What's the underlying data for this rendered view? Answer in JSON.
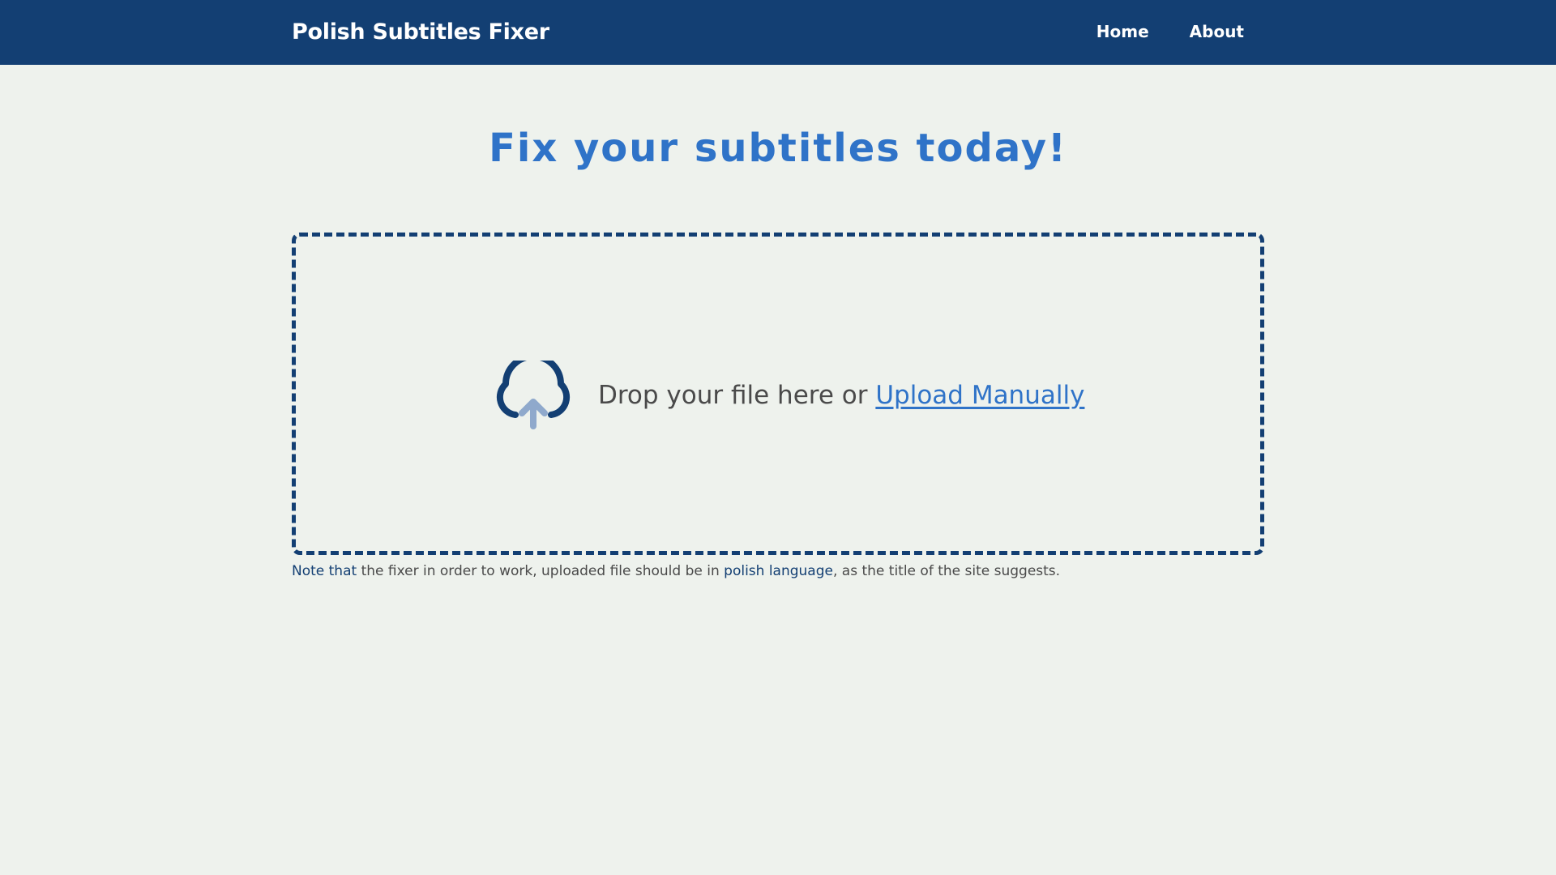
{
  "navbar": {
    "brand": "Polish Subtitles Fixer",
    "links": [
      {
        "label": "Home"
      },
      {
        "label": "About"
      }
    ]
  },
  "main": {
    "title": "Fix your subtitles today!",
    "dropzone": {
      "text": "Drop your file here or ",
      "link_label": "Upload Manually",
      "icon": "cloud-upload-icon"
    },
    "note": {
      "part1": "Note that",
      "part2": " the fixer in order to work, uploaded file should be in ",
      "part3": "polish language",
      "part4": ", as the title of the site suggests."
    }
  },
  "colors": {
    "navbar_bg": "#133f73",
    "accent": "#2f73c8",
    "page_bg": "#eef2ed",
    "icon_arrow": "#8fa9cc"
  }
}
